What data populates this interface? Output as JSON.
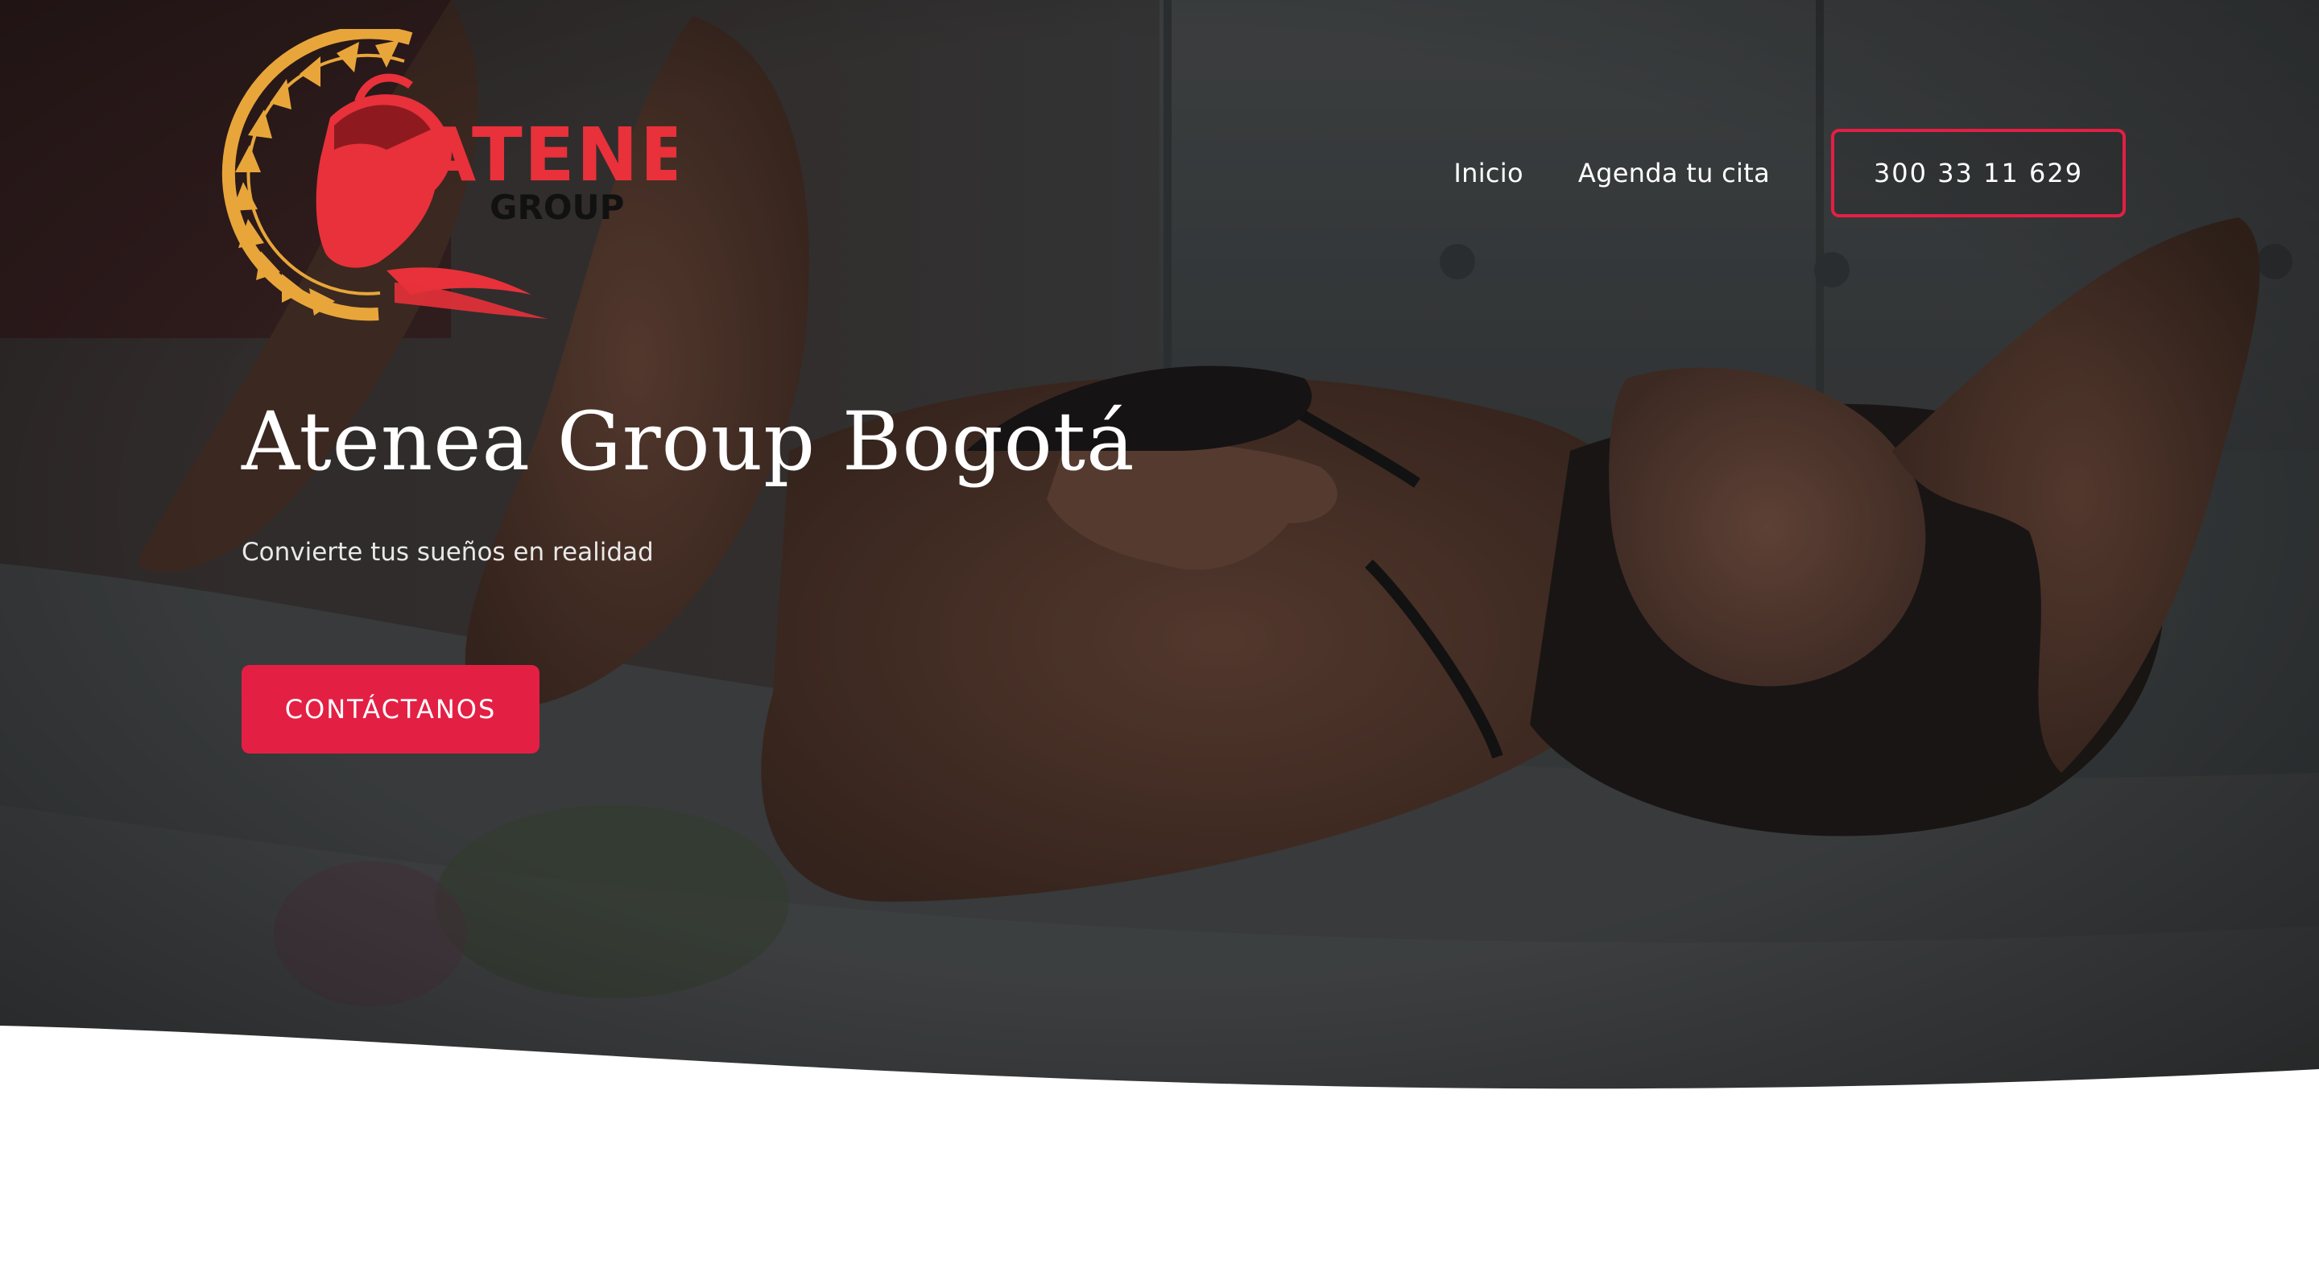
{
  "brand": {
    "name": "ATENEA",
    "tagline": "GROUP",
    "logo_icon": "spartan-helmet-icon"
  },
  "nav": {
    "items": [
      {
        "label": "Inicio"
      },
      {
        "label": "Agenda tu cita"
      }
    ],
    "phone_label": "300 33 11 629"
  },
  "hero": {
    "title": "Atenea Group Bogotá",
    "subtitle": "Convierte tus sueños en realidad",
    "cta_label": "CONTÁCTANOS"
  },
  "colors": {
    "accent": "#e41f44",
    "logo_gold": "#e8a63a",
    "logo_red": "#e8313a",
    "hero_dark": "#2b2b2c",
    "text": "#ffffff"
  }
}
